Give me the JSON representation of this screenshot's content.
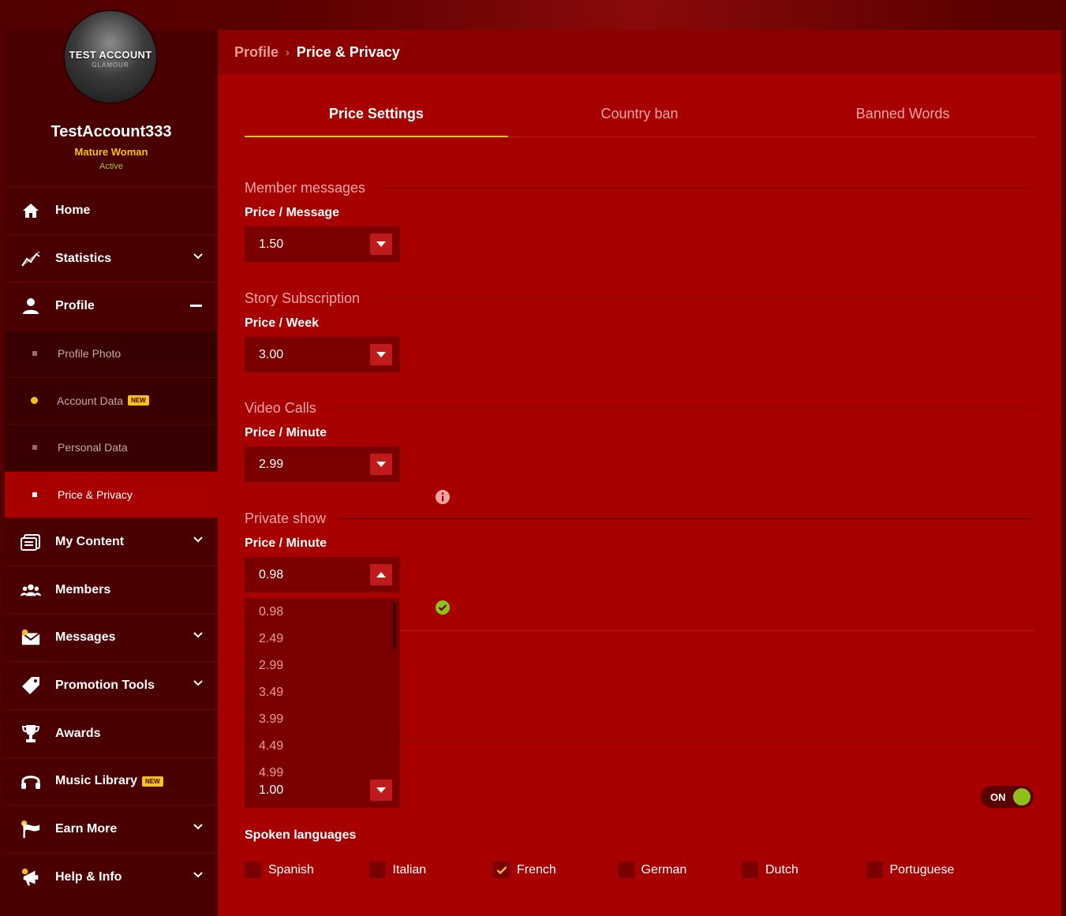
{
  "profile": {
    "avatar_title": "TEST ACCOUNT",
    "avatar_sub": "GLAMOUR",
    "username": "TestAccount333",
    "category": "Mature Woman",
    "status": "Active"
  },
  "nav": {
    "home": "Home",
    "statistics": "Statistics",
    "profile": "Profile",
    "sub": {
      "profile_photo": "Profile Photo",
      "account_data": "Account Data",
      "personal_data": "Personal Data",
      "price_privacy": "Price & Privacy"
    },
    "my_content": "My Content",
    "members": "Members",
    "messages": "Messages",
    "promotion_tools": "Promotion Tools",
    "awards": "Awards",
    "music_library": "Music Library",
    "earn_more": "Earn More",
    "help_info": "Help & Info",
    "new_badge": "NEW"
  },
  "breadcrumb": {
    "parent": "Profile",
    "separator": "›",
    "current": "Price & Privacy"
  },
  "tabs": [
    "Price Settings",
    "Country ban",
    "Banned Words"
  ],
  "sections": {
    "member_messages": {
      "title": "Member messages",
      "label": "Price / Message",
      "value": "1.50"
    },
    "story_subscription": {
      "title": "Story Subscription",
      "label": "Price / Week",
      "value": "3.00"
    },
    "video_calls": {
      "title": "Video Calls",
      "label": "Price / Minute",
      "value": "2.99"
    },
    "private_show": {
      "title": "Private show",
      "label": "Price / Minute",
      "value": "0.98"
    },
    "hidden_field": {
      "value": "1.00"
    }
  },
  "dropdown_options": [
    "0.98",
    "2.49",
    "2.99",
    "3.49",
    "3.99",
    "4.49",
    "4.99"
  ],
  "toggle": {
    "label": "ON",
    "state": true
  },
  "spoken_languages": {
    "label": "Spoken languages",
    "items": [
      {
        "name": "Spanish",
        "checked": false
      },
      {
        "name": "Italian",
        "checked": false
      },
      {
        "name": "French",
        "checked": true
      },
      {
        "name": "German",
        "checked": false
      },
      {
        "name": "Dutch",
        "checked": false
      },
      {
        "name": "Portuguese",
        "checked": false
      }
    ]
  },
  "colors": {
    "accent": "#f4c21b",
    "success": "#8ec21b",
    "main_bg": "#a60000",
    "sidebar_bg": "#4a0000"
  },
  "icons": {
    "home": "home-icon",
    "statistics": "chart-line-icon",
    "profile": "user-icon",
    "my_content": "content-icon",
    "members": "members-icon",
    "messages": "envelope-icon",
    "promotion_tools": "tag-icon",
    "awards": "trophy-icon",
    "music_library": "headphones-icon",
    "earn_more": "flag-icon",
    "help_info": "megaphone-icon"
  }
}
